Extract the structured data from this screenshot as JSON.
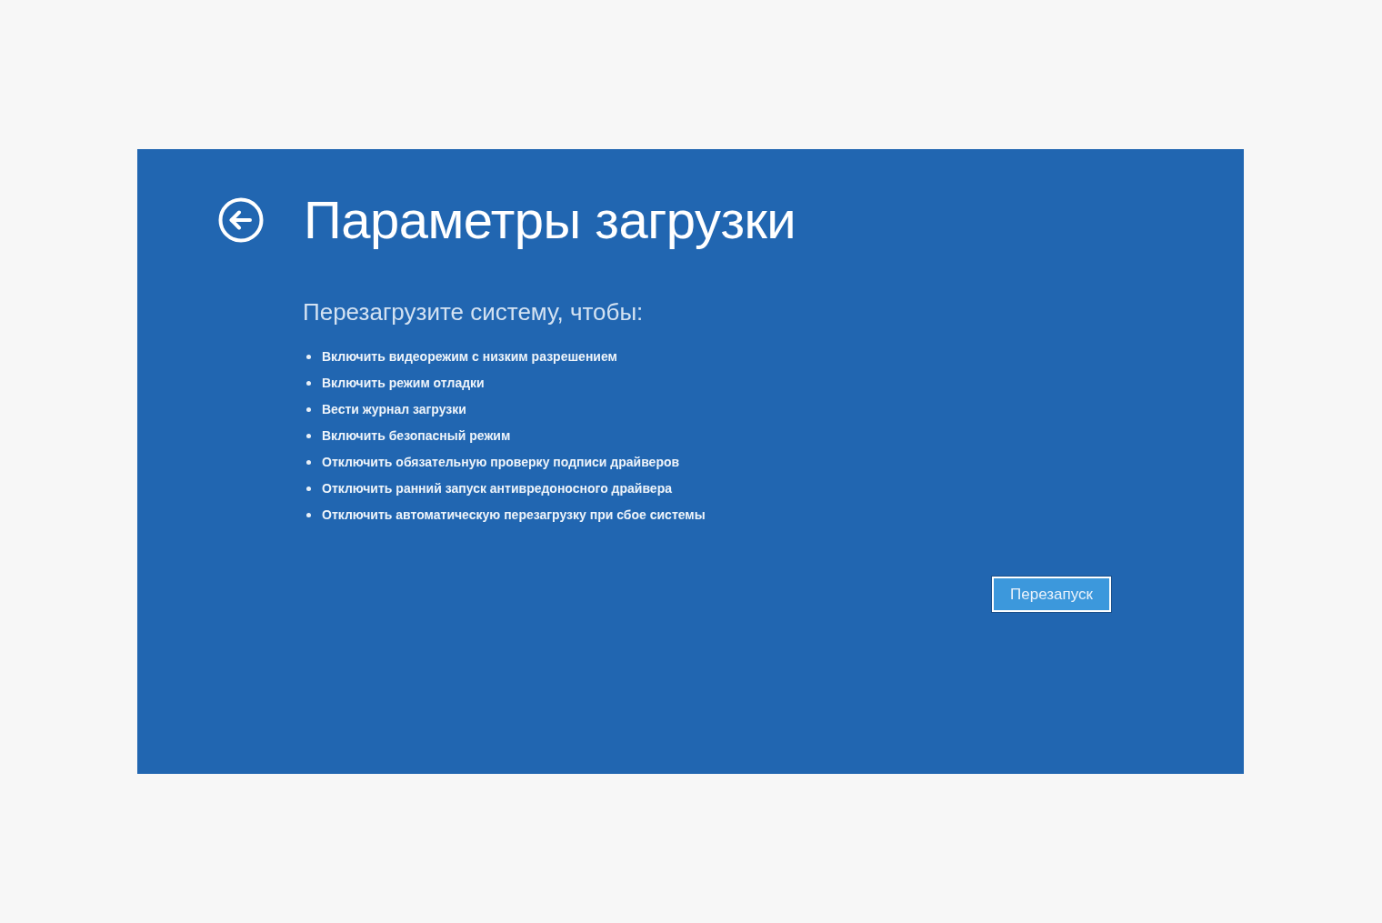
{
  "header": {
    "title": "Параметры загрузки"
  },
  "instructions": {
    "heading": "Перезагрузите систему, чтобы:",
    "items": [
      "Включить видеорежим с низким разрешением",
      "Включить режим отладки",
      "Вести журнал загрузки",
      "Включить безопасный режим",
      "Отключить обязательную проверку подписи драйверов",
      "Отключить ранний запуск антивредоносного драйвера",
      "Отключить автоматическую перезагрузку при сбое системы"
    ]
  },
  "restart_button": {
    "label": "Перезапуск"
  }
}
